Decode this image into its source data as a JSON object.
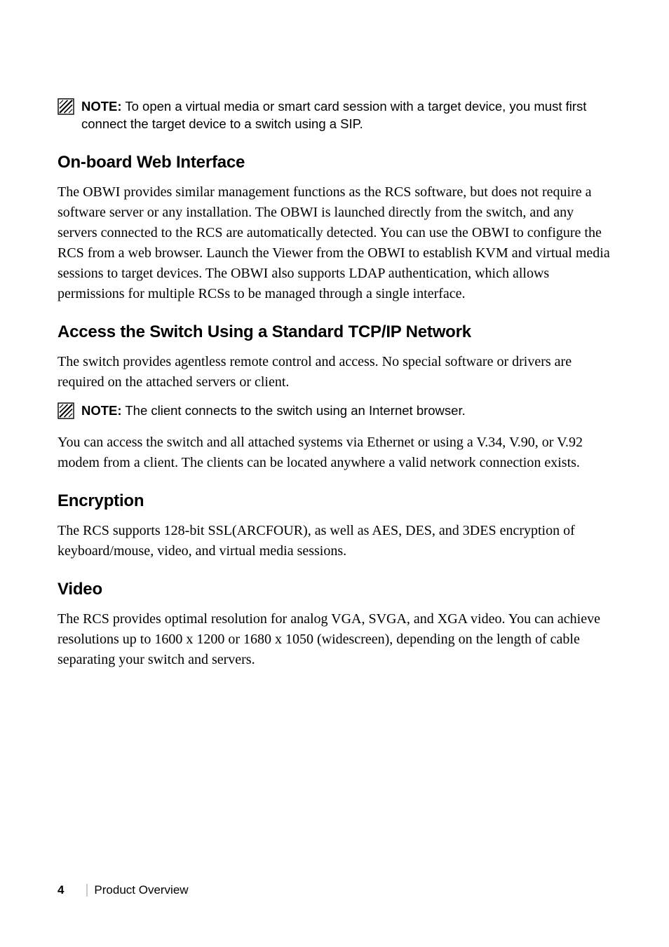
{
  "note1": {
    "label": "NOTE:",
    "text": " To open a virtual media or smart card session with a target device, you must first connect the target device to a switch using a SIP."
  },
  "section1": {
    "heading": "On-board Web Interface",
    "body": "The OBWI provides similar management functions as the RCS software, but does not require a software server or any installation. The OBWI is launched directly from the switch, and any servers connected to the RCS are automatically detected. You can use the OBWI to configure the RCS from a web browser. Launch the Viewer from the OBWI to establish KVM and virtual media sessions to target devices. The OBWI also supports LDAP authentication, which allows permissions for multiple RCSs to be managed through a single interface."
  },
  "section2": {
    "heading": "Access the Switch Using a Standard TCP/IP Network",
    "body1": "The switch provides agentless remote control and access. No special software or drivers are required on the attached servers or client.",
    "note": {
      "label": "NOTE:",
      "text": " The client connects to the switch using an Internet browser."
    },
    "body2": "You can access the switch and all attached systems via Ethernet or using a V.34, V.90, or V.92 modem from a client. The clients can be located anywhere a valid network connection exists."
  },
  "section3": {
    "heading": "Encryption",
    "body": "The RCS supports 128-bit SSL(ARCFOUR), as well as AES, DES, and 3DES encryption of keyboard/mouse, video, and virtual media sessions."
  },
  "section4": {
    "heading": "Video",
    "body": "The RCS provides optimal resolution for analog VGA, SVGA, and XGA video. You can achieve resolutions up to 1600 x 1200 or 1680 x 1050 (widescreen), depending on the length of cable separating your switch and servers."
  },
  "footer": {
    "page_number": "4",
    "section_title": "Product Overview"
  }
}
